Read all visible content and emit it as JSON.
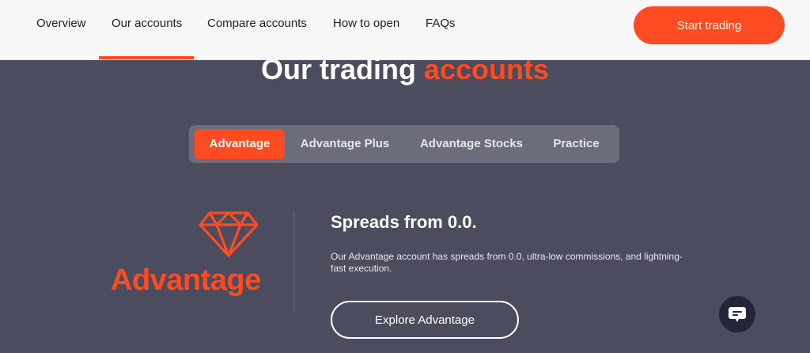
{
  "nav": {
    "items": [
      {
        "label": "Overview"
      },
      {
        "label": "Our accounts"
      },
      {
        "label": "Compare accounts"
      },
      {
        "label": "How to open"
      },
      {
        "label": "FAQs"
      }
    ],
    "active_index": 1,
    "cta_label": "Start trading"
  },
  "hero": {
    "title_prefix": "Our trading",
    "title_accent": "accounts"
  },
  "tabs": [
    {
      "label": "Advantage",
      "active": true
    },
    {
      "label": "Advantage Plus",
      "active": false
    },
    {
      "label": "Advantage Stocks",
      "active": false
    },
    {
      "label": "Practice",
      "active": false
    }
  ],
  "account": {
    "icon": "diamond-icon",
    "name": "Advantage",
    "headline": "Spreads from 0.0.",
    "description": "Our Advantage account has spreads from 0.0, ultra-low commissions, and lightning-fast execution.",
    "cta_label": "Explore Advantage"
  },
  "chat": {
    "icon": "chat-icon"
  },
  "colors": {
    "accent": "#ff4b22",
    "background": "#4b4c5d",
    "topbar": "#f7f7f7",
    "tab_bar": "#6c6d7c"
  }
}
